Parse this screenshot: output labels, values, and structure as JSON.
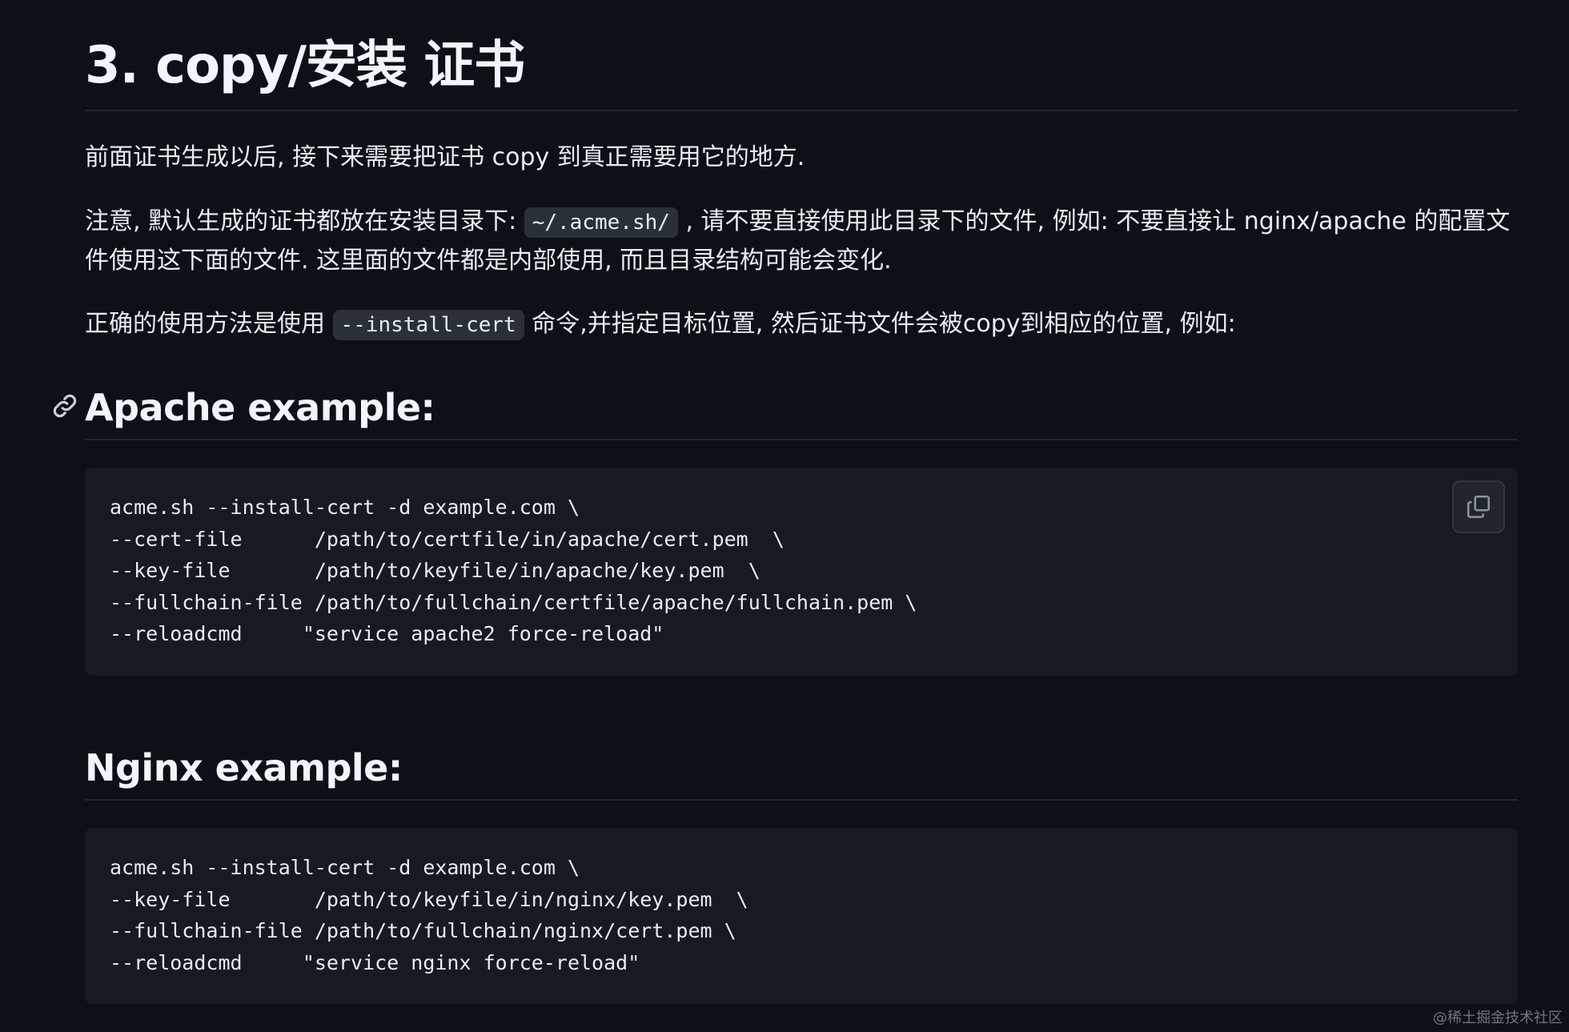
{
  "heading": "3. copy/安装 证书",
  "intro": "前面证书生成以后, 接下来需要把证书 copy 到真正需要用它的地方.",
  "note": {
    "before": "注意, 默认生成的证书都放在安装目录下: ",
    "code": "~/.acme.sh/",
    "after": " , 请不要直接使用此目录下的文件, 例如: 不要直接让 nginx/apache 的配置文件使用这下面的文件. 这里面的文件都是内部使用, 而且目录结构可能会变化."
  },
  "usage": {
    "before": "正确的使用方法是使用 ",
    "code": "--install-cert",
    "after": " 命令,并指定目标位置, 然后证书文件会被copy到相应的位置, 例如:"
  },
  "apache": {
    "title": "Apache example:",
    "anchor_icon": "link-icon",
    "copy_icon": "copy-icon",
    "code": "acme.sh --install-cert -d example.com \\\n--cert-file      /path/to/certfile/in/apache/cert.pem  \\\n--key-file       /path/to/keyfile/in/apache/key.pem  \\\n--fullchain-file /path/to/fullchain/certfile/apache/fullchain.pem \\\n--reloadcmd     \"service apache2 force-reload\""
  },
  "nginx": {
    "title": "Nginx example:",
    "code": "acme.sh --install-cert -d example.com \\\n--key-file       /path/to/keyfile/in/nginx/key.pem  \\\n--fullchain-file /path/to/fullchain/nginx/cert.pem \\\n--reloadcmd     \"service nginx force-reload\""
  },
  "watermark": "@稀土掘金技术社区"
}
